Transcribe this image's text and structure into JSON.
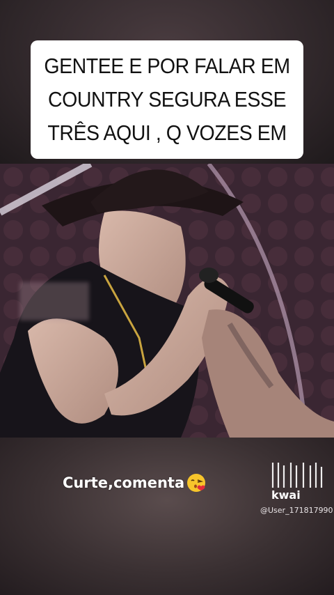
{
  "caption": {
    "lines": [
      "GENTEE E POR FALAR EM",
      "COUNTRY SEGURA ESSE",
      "TRÊS AQUI , Q VOZES EM"
    ]
  },
  "overlay_text": "Curte,comenta",
  "overlay_emoji": "face-blowing-kiss-icon",
  "watermark": {
    "brand": "kwai",
    "user": "@User_171817990"
  },
  "video": {
    "subject": "singer-in-cowboy-hat-with-microphone",
    "colors": {
      "stage_bg": "#3a2632",
      "hat": "#1e1416",
      "skin": "#c9a89c",
      "vest": "#17141a"
    }
  }
}
